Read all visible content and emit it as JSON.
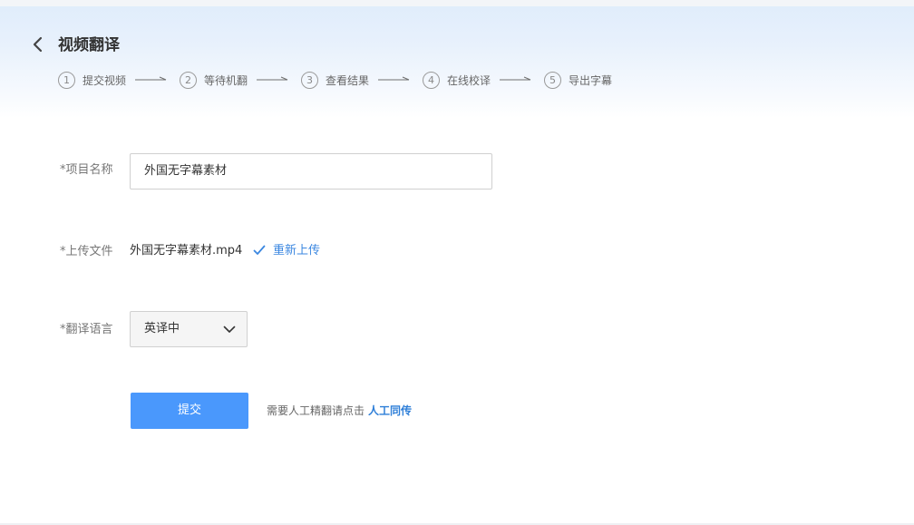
{
  "header": {
    "title": "视频翻译",
    "back_icon": "chevron-left-icon"
  },
  "steps": [
    {
      "num": "1",
      "label": "提交视频"
    },
    {
      "num": "2",
      "label": "等待机翻"
    },
    {
      "num": "3",
      "label": "查看结果"
    },
    {
      "num": "4",
      "label": "在线校译"
    },
    {
      "num": "5",
      "label": "导出字幕"
    }
  ],
  "form": {
    "project_name": {
      "label": "*项目名称",
      "value": "外国无字幕素材"
    },
    "upload": {
      "label": "*上传文件",
      "file_name": "外国无字幕素材.mp4",
      "status_icon": "check-icon",
      "reupload_label": "重新上传"
    },
    "language": {
      "label": "*翻译语言",
      "selected": "英译中",
      "icon": "chevron-down-icon"
    }
  },
  "actions": {
    "submit_label": "提交",
    "hint_text": "需要人工精翻请点击",
    "hint_link": "人工同传"
  },
  "colors": {
    "accent": "#4a98fc",
    "link": "#3b87e0",
    "header_gradient_top": "#dfecfb"
  }
}
